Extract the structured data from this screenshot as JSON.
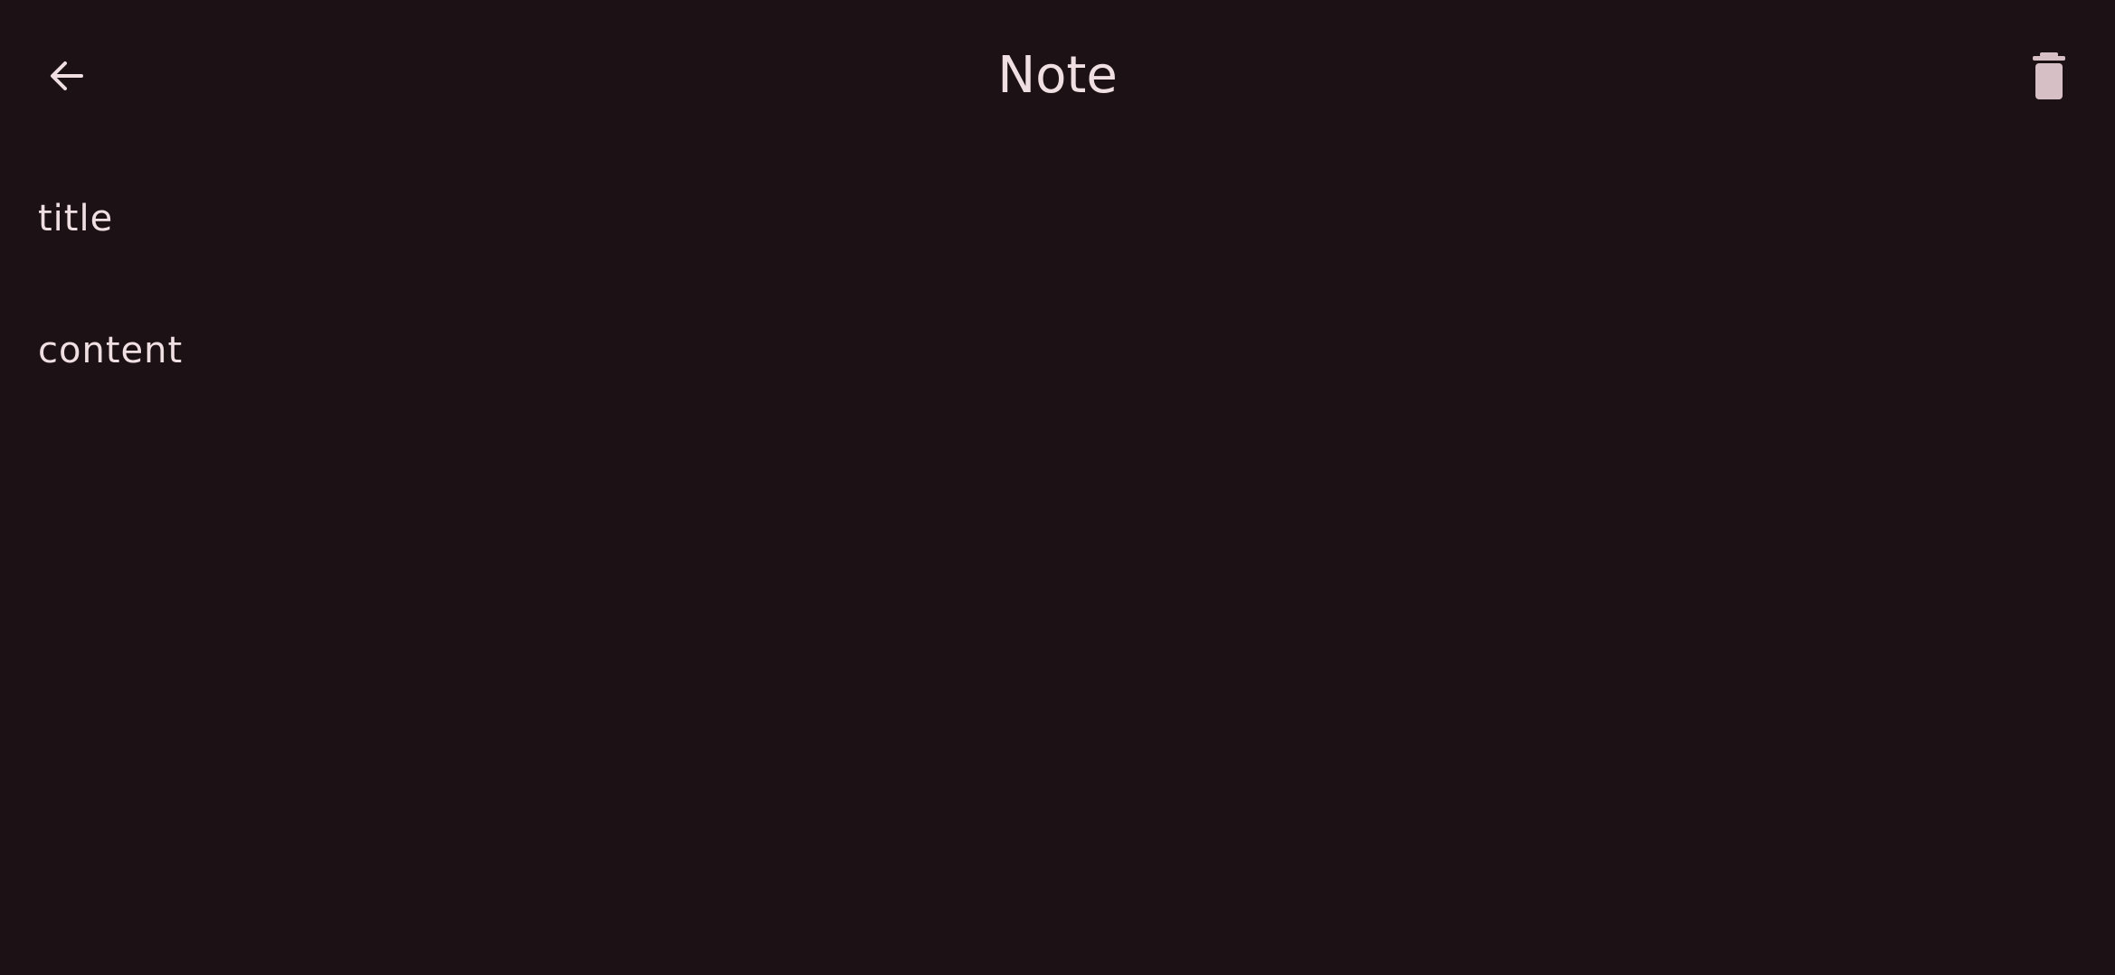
{
  "app": {
    "title": "Note"
  },
  "toolbar": {
    "back_icon": "arrow-back-icon",
    "delete_icon": "trash-icon"
  },
  "note": {
    "title_value": "title",
    "content_value": "content"
  },
  "colors": {
    "background": "#1c1114",
    "text": "#efdfe3",
    "icon_muted": "#d7c0c5"
  }
}
